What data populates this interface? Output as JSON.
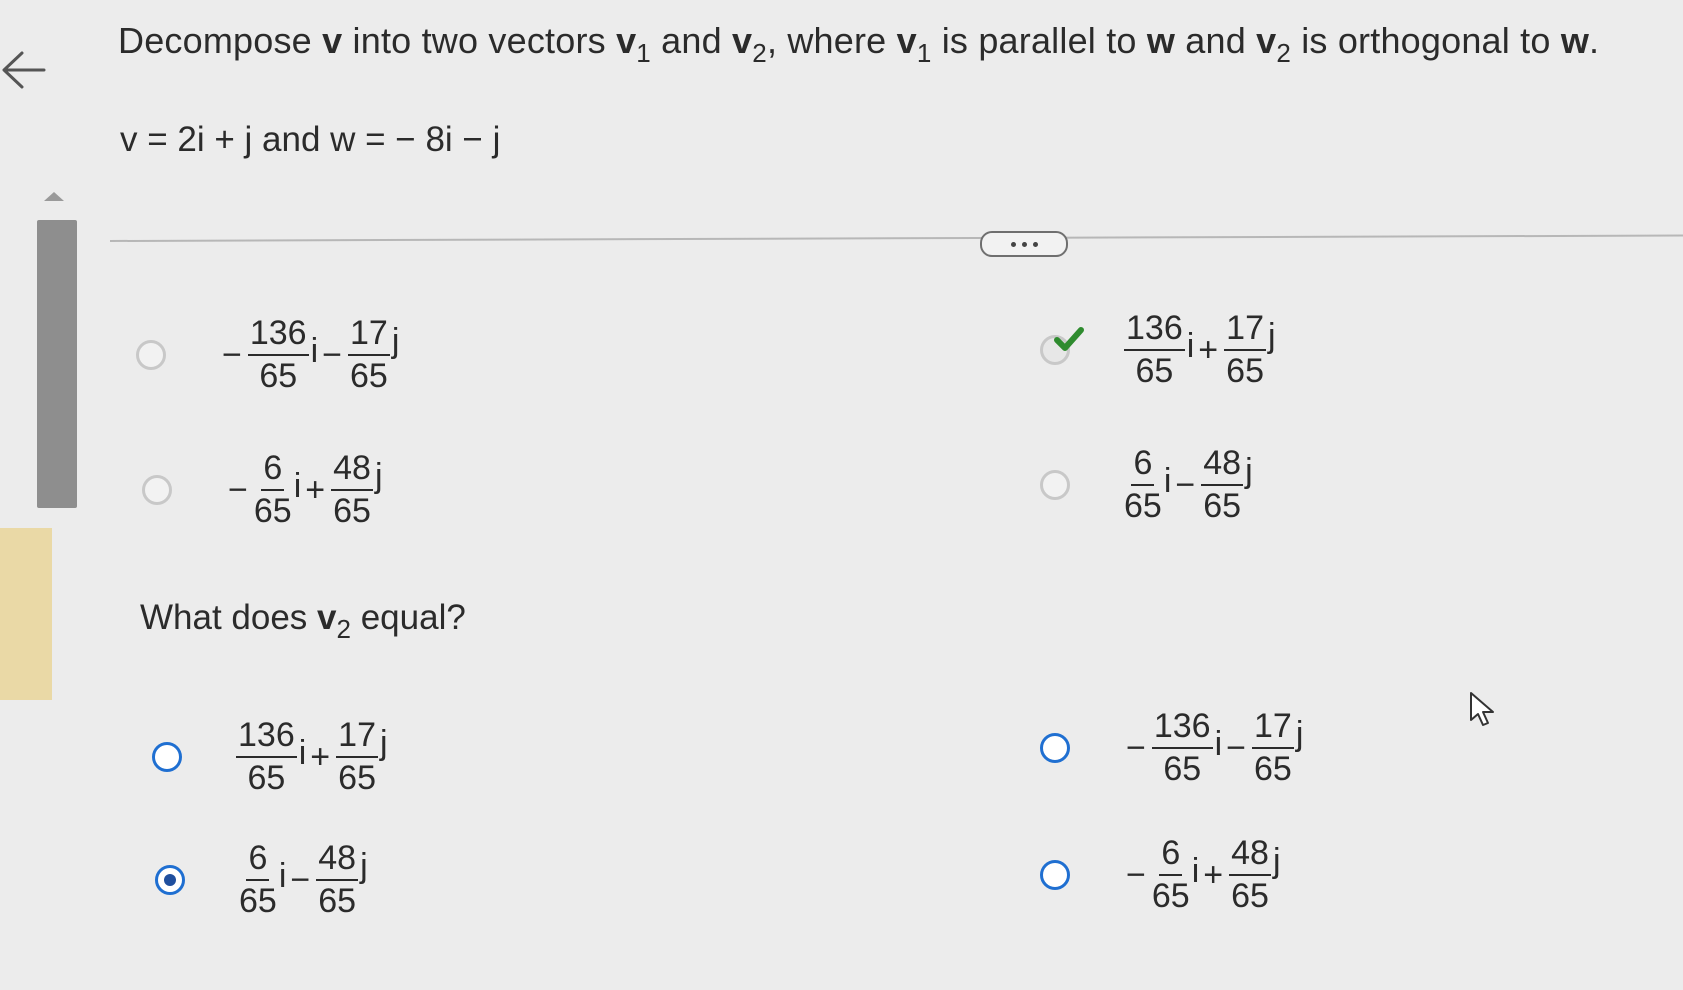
{
  "nav": {
    "back_icon": "arrow-left-icon"
  },
  "problem": {
    "instruction_parts": [
      "Decompose ",
      "v",
      " into two vectors ",
      "v",
      "1",
      " and ",
      "v",
      "2",
      ", where ",
      "v",
      "1",
      " is parallel to ",
      "w",
      " and ",
      "v",
      "2",
      " is orthogonal to ",
      "w",
      "."
    ],
    "given": "v = 2i + j and w = − 8i − j"
  },
  "more_button_icon": "ellipsis-icon",
  "part1_options": [
    {
      "state": "faded",
      "sign1": "−",
      "num1": "136",
      "den1": "65",
      "unit1": "i",
      "op": "−",
      "num2": "17",
      "den2": "65",
      "unit2": "j"
    },
    {
      "state": "check",
      "sign1": "",
      "num1": "136",
      "den1": "65",
      "unit1": "i",
      "op": "+",
      "num2": "17",
      "den2": "65",
      "unit2": "j"
    },
    {
      "state": "faded",
      "sign1": "−",
      "num1": "6",
      "den1": "65",
      "unit1": "i",
      "op": "+",
      "num2": "48",
      "den2": "65",
      "unit2": "j"
    },
    {
      "state": "faded",
      "sign1": "",
      "num1": "6",
      "den1": "65",
      "unit1": "i",
      "op": "−",
      "num2": "48",
      "den2": "65",
      "unit2": "j"
    }
  ],
  "question": {
    "pre": "What does ",
    "v": "v",
    "sub": "2",
    "post": " equal?"
  },
  "part2_options": [
    {
      "state": "blue",
      "sign1": "",
      "num1": "136",
      "den1": "65",
      "unit1": "i",
      "op": "+",
      "num2": "17",
      "den2": "65",
      "unit2": "j"
    },
    {
      "state": "blue",
      "sign1": "−",
      "num1": "136",
      "den1": "65",
      "unit1": "i",
      "op": "−",
      "num2": "17",
      "den2": "65",
      "unit2": "j"
    },
    {
      "state": "sel",
      "sign1": "",
      "num1": "6",
      "den1": "65",
      "unit1": "i",
      "op": "−",
      "num2": "48",
      "den2": "65",
      "unit2": "j"
    },
    {
      "state": "blue",
      "sign1": "−",
      "num1": "6",
      "den1": "65",
      "unit1": "i",
      "op": "+",
      "num2": "48",
      "den2": "65",
      "unit2": "j"
    }
  ],
  "colors": {
    "accent_blue": "#1f6fd1",
    "selected_dot": "#1f4f9e",
    "check_green": "#2e8b2e"
  }
}
